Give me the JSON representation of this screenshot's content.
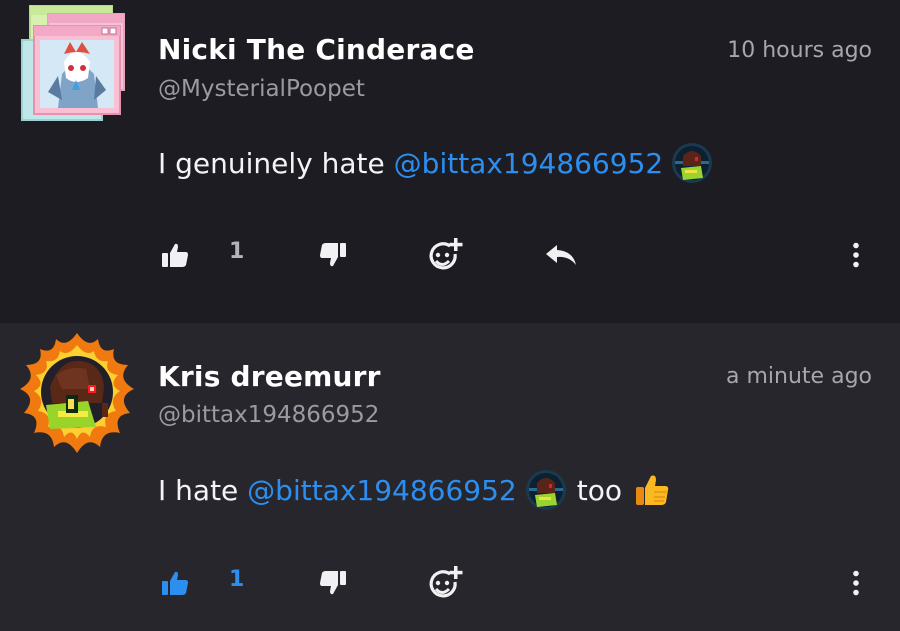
{
  "posts": [
    {
      "author": "Nicki The Cinderace",
      "handle": "@MysterialPoopet",
      "time": "10 hours ago",
      "text_before": "I genuinely hate ",
      "mention": "@bittax194866952",
      "text_after": "",
      "likes": "1",
      "liked": false
    },
    {
      "author": "Kris dreemurr",
      "handle": "@bittax194866952",
      "time": "a minute ago",
      "text_before": "I hate ",
      "mention": "@bittax194866952",
      "text_after": "too",
      "likes": "1",
      "liked": true
    }
  ],
  "colors": {
    "background": "#1d1c22",
    "selected_post_background": "#27262c",
    "accent": "#2c8ff0",
    "secondary_text": "#9b9aa2"
  },
  "icons": [
    "thumbs-up-icon",
    "thumbs-down-icon",
    "add-reaction-icon",
    "reply-icon",
    "more-vertical-icon",
    "thumbs-up-emoji"
  ]
}
